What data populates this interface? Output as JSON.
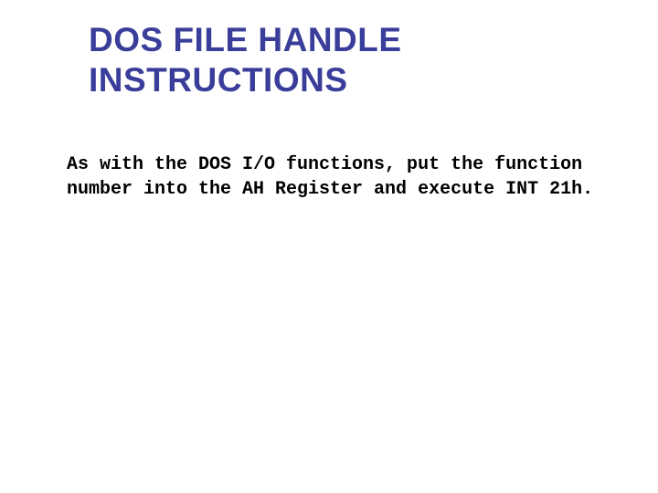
{
  "slide": {
    "title": "DOS FILE HANDLE INSTRUCTIONS",
    "body": "As with the DOS I/O functions, put the function number into the AH Register and execute INT 21h."
  }
}
